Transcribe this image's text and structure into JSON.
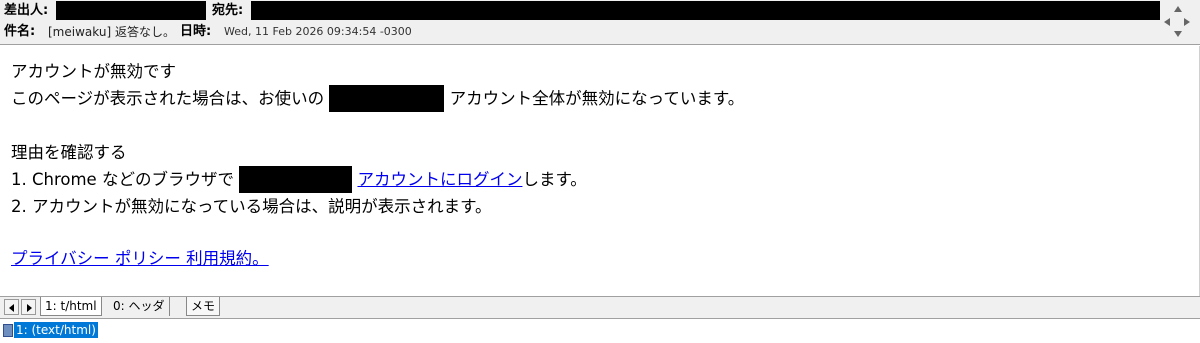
{
  "header": {
    "from_label": "差出人:",
    "to_label": "宛先:",
    "subject_label": "件名:",
    "subject_value": "[meiwaku] 返答なし。",
    "date_label": "日時:",
    "date_value": "Wed, 11 Feb 2026 09:34:54 -0300"
  },
  "message": {
    "line1": "アカウントが無効です",
    "line2_before": "このページが表示された場合は、お使いの",
    "line2_after": "アカウント全体が無効になっています。",
    "line4": "理由を確認する",
    "line5_before": "1. Chrome などのブラウザで",
    "line5_link": "アカウントにログイン",
    "line5_after": "します。",
    "line6": "2. アカウントが無効になっている場合は、説明が表示されます。",
    "footer_link": "プライバシー ポリシー 利用規約。"
  },
  "tabs": [
    {
      "label": "1: t/html"
    },
    {
      "label": "0: ヘッダ"
    },
    {
      "label": "メモ"
    }
  ],
  "parts": {
    "selected_label": "1: (text/html)"
  }
}
